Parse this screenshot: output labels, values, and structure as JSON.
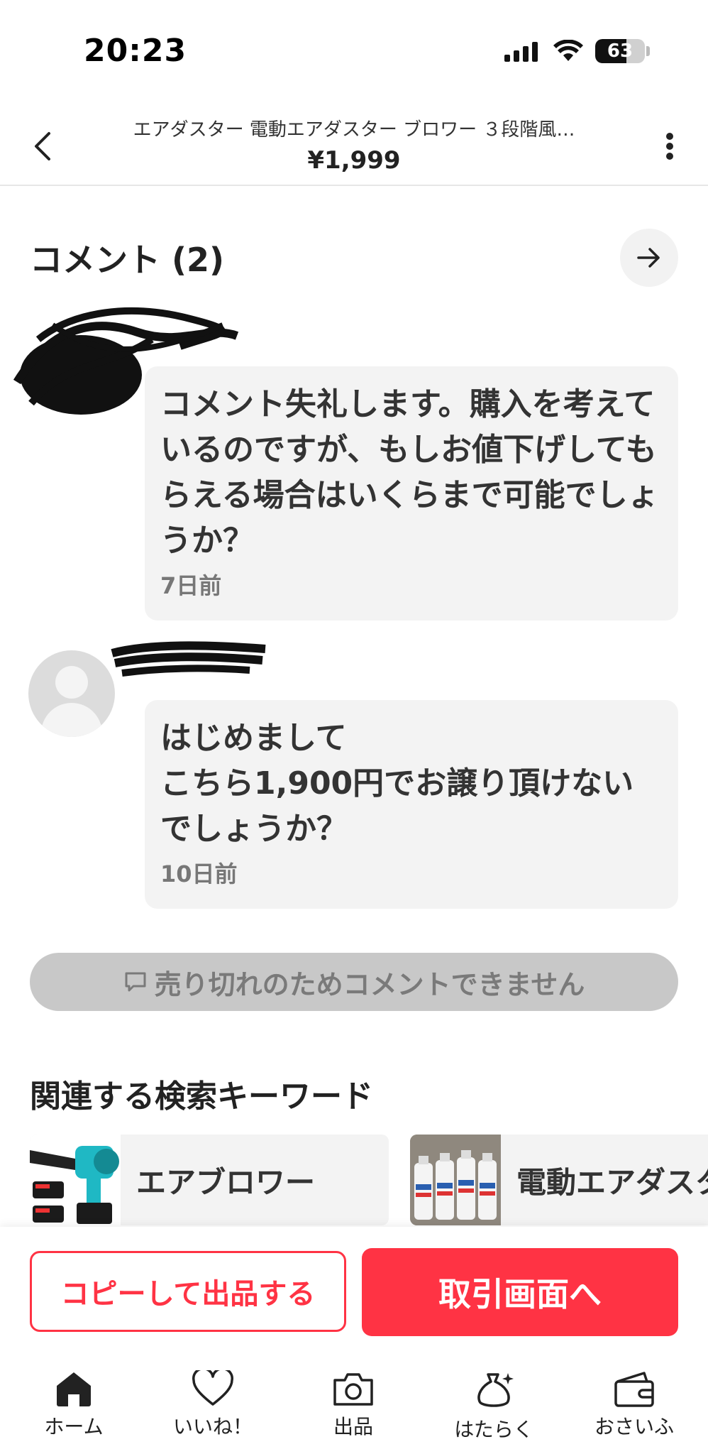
{
  "status_bar": {
    "time": "20:23",
    "battery_level": 63,
    "battery_text": "63"
  },
  "header": {
    "title": "エアダスター 電動エアダスター ブロワー ３段階風…",
    "price": "¥1,999"
  },
  "comments": {
    "heading": "コメント (2)",
    "items": [
      {
        "text": "コメント失礼します。購入を考えているのですが、もしお値下げしてもらえる場合はいくらまで可能でしょうか？",
        "time": "7日前"
      },
      {
        "text": "はじめまして\nこちら1,900円でお譲り頂けないでしょうか？",
        "time": "10日前"
      }
    ],
    "disabled_notice": "売り切れのためコメントできません"
  },
  "keywords": {
    "heading": "関連する検索キーワード",
    "items": [
      {
        "label": "エアブロワー",
        "thumb_icon": "blower-product-icon"
      },
      {
        "label": "電動エアダスタ",
        "thumb_icon": "air-duster-cans-icon"
      }
    ]
  },
  "actions": {
    "copy_label": "コピーして出品する",
    "trade_label": "取引画面へ"
  },
  "tabs": [
    {
      "label": "ホーム",
      "icon": "home-icon"
    },
    {
      "label": "いいね！",
      "icon": "heart-icon"
    },
    {
      "label": "出品",
      "icon": "camera-icon"
    },
    {
      "label": "はたらく",
      "icon": "money-bag-icon"
    },
    {
      "label": "おさいふ",
      "icon": "wallet-icon"
    }
  ],
  "colors": {
    "accent": "#ff3344",
    "bubble": "#f3f3f3",
    "disabled": "#c8c8c8"
  }
}
